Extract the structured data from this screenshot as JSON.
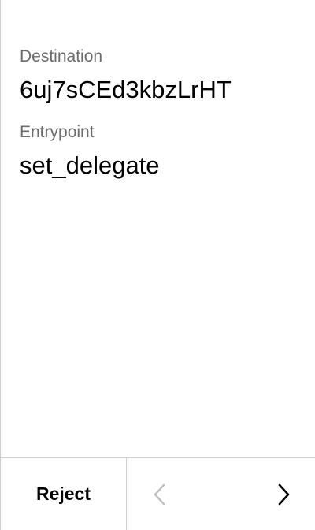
{
  "fields": [
    {
      "label": "Destination",
      "value": "6uj7sCEd3kbzLrHT"
    },
    {
      "label": "Entrypoint",
      "value": "set_delegate"
    }
  ],
  "footer": {
    "reject_label": "Reject",
    "prev_icon": "chevron-left-icon",
    "next_icon": "chevron-right-icon",
    "prev_enabled": false,
    "next_enabled": true
  },
  "colors": {
    "label": "#6b6b6b",
    "value": "#000000",
    "divider": "#cfcfcf",
    "disabled_icon": "#bdbdbd",
    "enabled_icon": "#000000"
  }
}
